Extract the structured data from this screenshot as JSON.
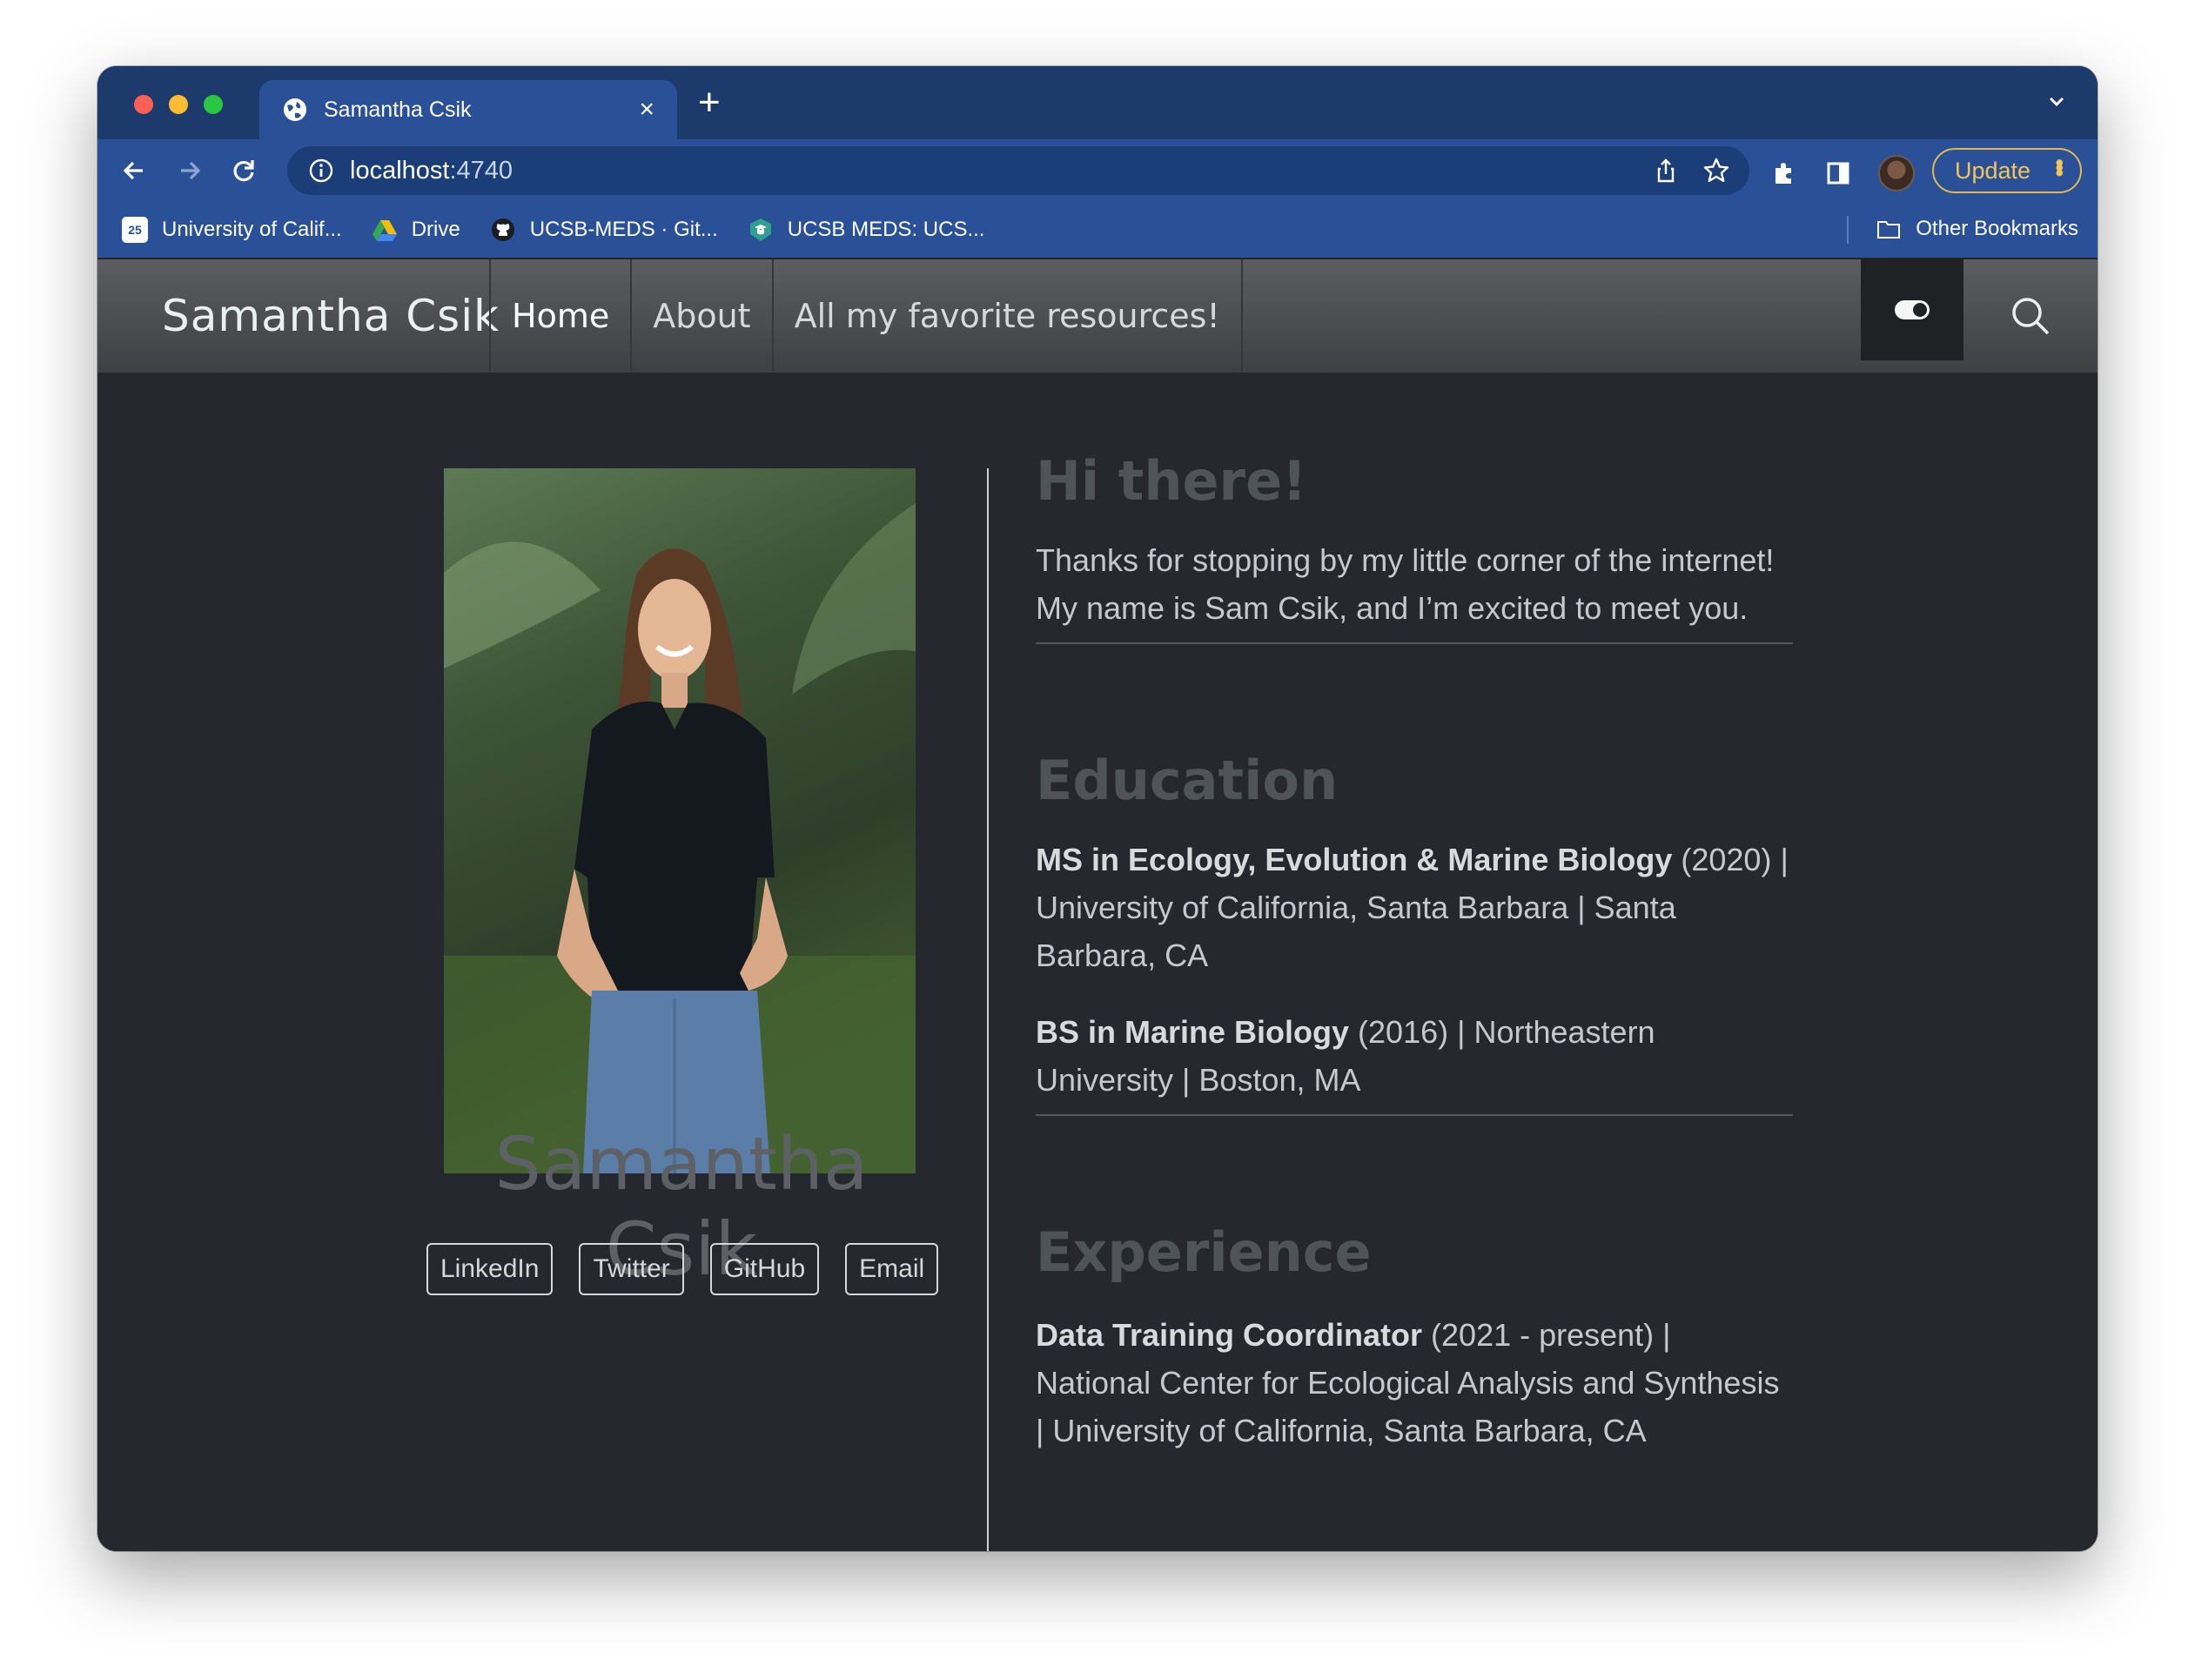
{
  "browser": {
    "tab_title": "Samantha Csik",
    "url_host": "localhost",
    "url_port": ":4740",
    "update_label": "Update",
    "bookmarks": [
      {
        "label": "University of Calif...",
        "icon": "calendar-icon"
      },
      {
        "label": "Drive",
        "icon": "drive-icon"
      },
      {
        "label": "UCSB-MEDS · Git...",
        "icon": "github-icon"
      },
      {
        "label": "UCSB MEDS: UCS...",
        "icon": "ucsb-icon"
      }
    ],
    "other_bookmarks": "Other Bookmarks"
  },
  "site": {
    "brand": "Samantha Csik",
    "nav": [
      "Home",
      "About",
      "All my favorite resources!"
    ]
  },
  "profile": {
    "name": "Samantha Csik",
    "links": [
      "LinkedIn",
      "Twitter",
      "GitHub",
      "Email"
    ]
  },
  "about": {
    "greeting_heading": "Hi there!",
    "greeting_text": "Thanks for stopping by my little corner of the internet! My name is Sam Csik, and I’m excited to meet you.",
    "education_heading": "Education",
    "education": [
      {
        "degree": "MS in Ecology, Evolution & Marine Biology",
        "rest": " (2020) | University of California, Santa Barbara | Santa Barbara, CA"
      },
      {
        "degree": "BS in Marine Biology",
        "rest": " (2016) | Northeastern University | Boston, MA"
      }
    ],
    "experience_heading": "Experience",
    "experience": [
      {
        "role": "Data Training Coordinator",
        "rest": " (2021 - present) | National Center for Ecological Analysis and Synthesis | University of California, Santa Barbara, CA"
      }
    ]
  }
}
